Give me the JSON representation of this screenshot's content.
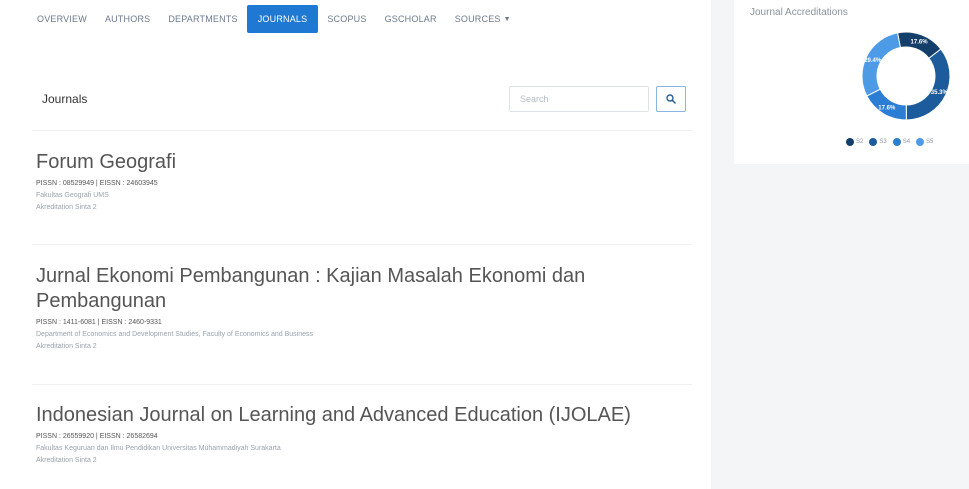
{
  "nav": {
    "items": [
      {
        "label": "Overview"
      },
      {
        "label": "Authors"
      },
      {
        "label": "Departments"
      },
      {
        "label": "Journals"
      },
      {
        "label": "Scopus"
      },
      {
        "label": "GScholar"
      },
      {
        "label": "Sources"
      }
    ],
    "active_index": 3
  },
  "journals_card": {
    "title": "Journals",
    "search_placeholder": "Search"
  },
  "journals": [
    {
      "title": "Forum Geografi",
      "issn": "PISSN : 08529949 | EISSN : 24603945",
      "department": "Fakultas Geografi UMS",
      "accreditation": "Akreditation Sinta 2"
    },
    {
      "title": "Jurnal Ekonomi Pembangunan : Kajian Masalah Ekonomi dan Pembangunan",
      "issn": "PISSN : 1411-6081 | EISSN : 2460-9331",
      "department": "Department of Economics and Development Studies, Faculty of Economics and Business",
      "accreditation": "Akreditation Sinta 2"
    },
    {
      "title": "Indonesian Journal on Learning and Advanced Education (IJOLAE)",
      "issn": "PISSN : 26559920 | EISSN : 26582694",
      "department": "Fakultas Keguruan dan Ilmu Pendidikan Universitas Muhammadiyah Surakarta",
      "accreditation": "Akreditation Sinta 2"
    }
  ],
  "accreditation_chart": {
    "title": "Journal Accreditations",
    "colors": {
      "s2": "#143f6b",
      "s3": "#1d5c9c",
      "s4": "#2c7dd4",
      "s5": "#4d9be6"
    },
    "chart_data": {
      "type": "pie",
      "categories": [
        "S2",
        "S3",
        "S4",
        "S5"
      ],
      "values": [
        17.6,
        35.3,
        17.6,
        29.4
      ],
      "slice_labels": [
        "17.6%",
        "35.3%",
        "17.6%",
        "29.4%"
      ],
      "legend_labels": [
        "S2",
        "S3",
        "S4",
        "S5"
      ],
      "legend_position": "bottom",
      "donut": true
    }
  }
}
